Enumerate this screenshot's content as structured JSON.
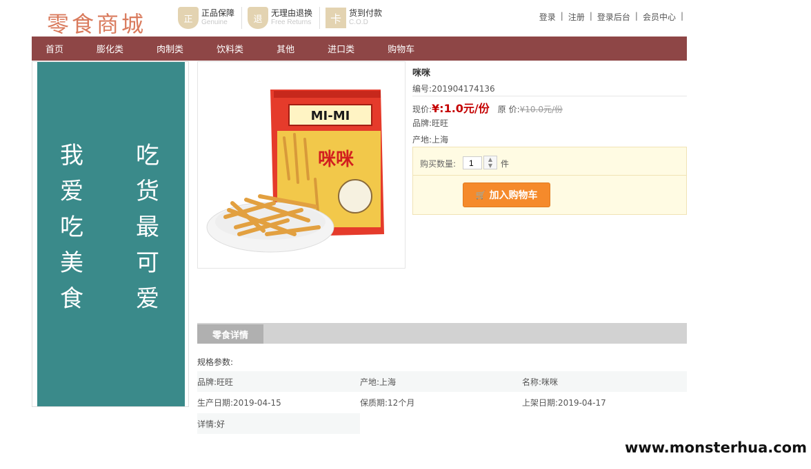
{
  "header": {
    "logo": "零食商城",
    "badges": [
      {
        "icon": "shield-icon",
        "glyph": "正",
        "zh": "正品保障",
        "en": "Genuine"
      },
      {
        "icon": "shield-icon",
        "glyph": "退",
        "zh": "无理由退换",
        "en": "Free Returns"
      },
      {
        "icon": "cod-icon",
        "glyph": "卡",
        "zh": "货到付款",
        "en": "C.O.D"
      }
    ],
    "links": [
      "登录",
      "注册",
      "登录后台",
      "会员中心"
    ]
  },
  "nav": [
    "首页",
    "膨化类",
    "肉制类",
    "饮料类",
    "其他",
    "进口类",
    "购物车"
  ],
  "banner": {
    "left": "我爱吃美食",
    "right": "吃货最可爱"
  },
  "product": {
    "name": "咪咪",
    "code": "编号:201904174136",
    "price_label": "现价:",
    "price_now": "¥:1.0元/份",
    "orig_label": "原 价:",
    "price_old": "¥10.0元/份",
    "brand": "品牌:旺旺",
    "origin": "产地:上海",
    "image_text": "咪咪",
    "image_brand": "MI-MI"
  },
  "buy": {
    "qty_label": "购买数量:",
    "qty_value": "1",
    "qty_unit": "件",
    "add_to_cart": "加入购物车"
  },
  "details": {
    "tab": "零食详情",
    "spec_label": "规格参数:",
    "rows": [
      [
        "品牌:旺旺",
        "产地:上海",
        "名称:咪咪"
      ],
      [
        "生产日期:2019-04-15",
        "保质期:12个月",
        "上架日期:2019-04-17"
      ]
    ],
    "extra": "详情:好"
  },
  "watermark": "www.monsterhua.com",
  "colors": {
    "nav": "#8e4646",
    "banner": "#3a8a8a",
    "price": "#c40000",
    "cart_button": "#f58a2b"
  }
}
